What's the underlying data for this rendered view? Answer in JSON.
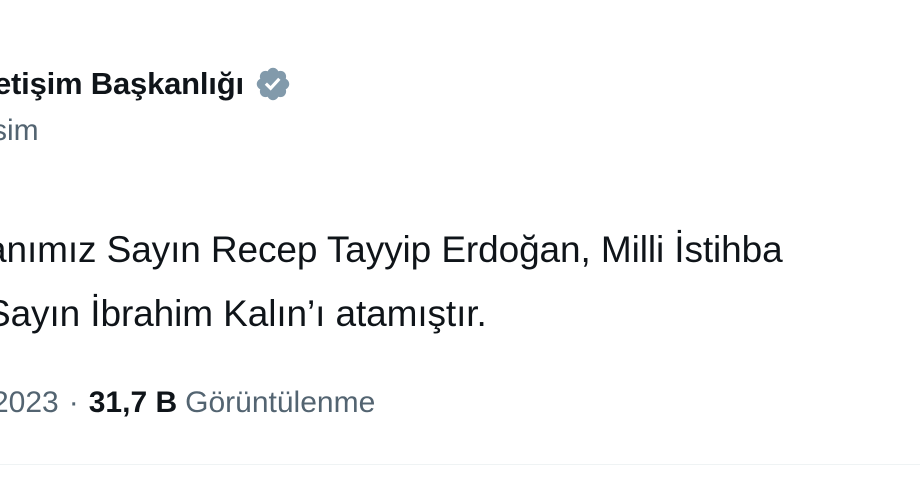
{
  "author": {
    "display_name": "etişim Başkanlığı",
    "handle": "sim",
    "verified_badge_icon": "verified-badge-icon",
    "badge_color": "#829aab"
  },
  "tweet": {
    "lines": [
      "anımız Sayın Recep Tayyip Erdoğan, Milli İstihba",
      " Sayın İbrahim Kalın’ı atamıştır."
    ]
  },
  "meta": {
    "date": "2023",
    "separator": "·",
    "views_count": "31,7 B",
    "views_label": "Görüntülenme"
  },
  "colors": {
    "text": "#0f1419",
    "secondary": "#536471",
    "divider": "#eff3f4"
  }
}
